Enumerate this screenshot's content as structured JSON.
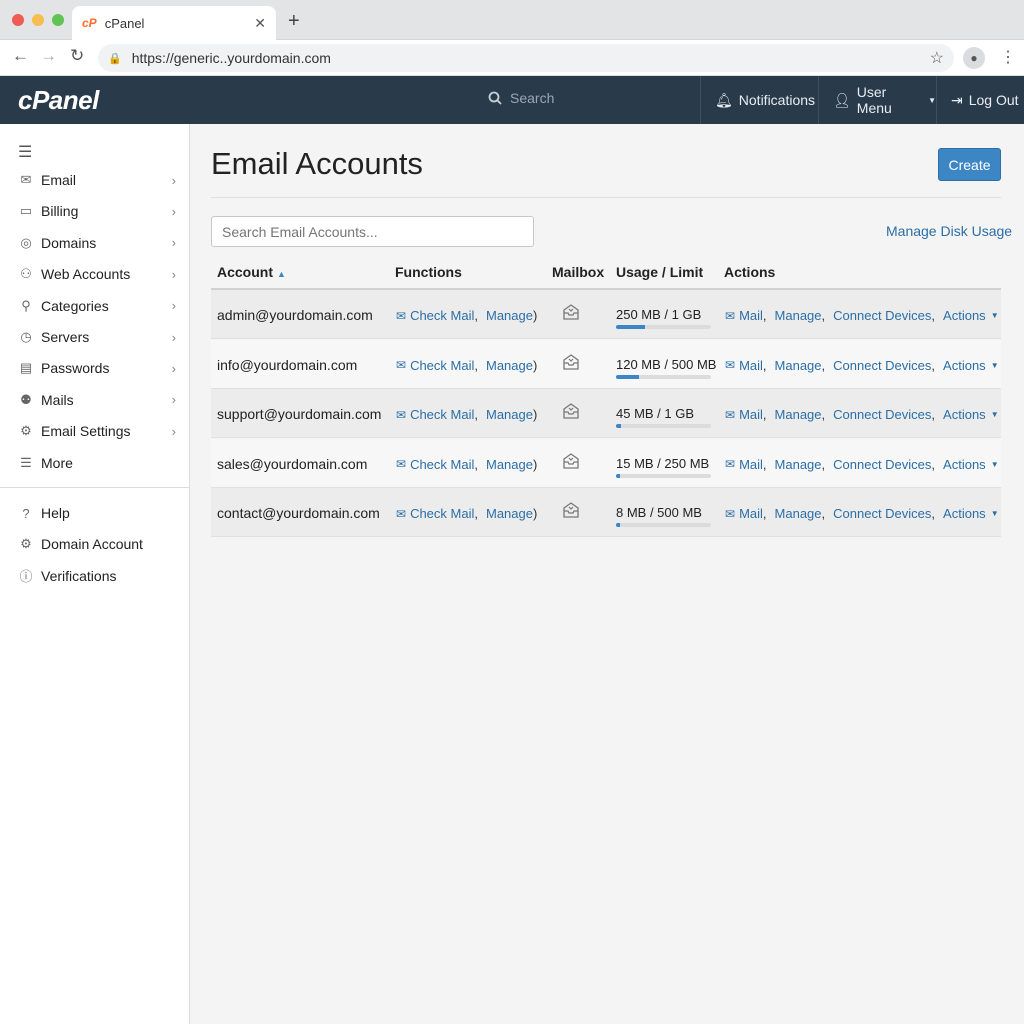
{
  "browser": {
    "tab_logo": "cP",
    "tab_title": "cPanel",
    "url": "https://generic..yourdomain.com"
  },
  "header": {
    "brand": "cPanel",
    "search_placeholder": "Search",
    "notifications": "Notifications",
    "user_menu": "User Menu",
    "log_out": "Log Out"
  },
  "sidebar": {
    "items": [
      {
        "label": "Email",
        "icon": "envelope-open-icon",
        "glyph": "✉"
      },
      {
        "label": "Billing",
        "icon": "billing-icon",
        "glyph": "▭"
      },
      {
        "label": "Domains",
        "icon": "globe-icon",
        "glyph": "◎"
      },
      {
        "label": "Web Accounts",
        "icon": "web-accounts-icon",
        "glyph": "⚇"
      },
      {
        "label": "Categories",
        "icon": "link-icon",
        "glyph": "⚲"
      },
      {
        "label": "Servers",
        "icon": "clock-icon",
        "glyph": "◷"
      },
      {
        "label": "Passwords",
        "icon": "folder-icon",
        "glyph": "▤"
      },
      {
        "label": "Mails",
        "icon": "users-icon",
        "glyph": "⚉"
      },
      {
        "label": "Email Settings",
        "icon": "gear-icon",
        "glyph": "⚙"
      },
      {
        "label": "More",
        "icon": "list-icon",
        "glyph": "☰"
      }
    ],
    "bottom_items": [
      {
        "label": "Help",
        "icon": "help-icon",
        "glyph": "?"
      },
      {
        "label": "Domain Account",
        "icon": "gear-icon",
        "glyph": "⚙"
      },
      {
        "label": "Verifications",
        "icon": "info-icon",
        "glyph": "ⓘ"
      }
    ]
  },
  "main": {
    "title": "Email Accounts",
    "create_label": "Create",
    "search_placeholder": "Search Email Accounts...",
    "manage_disk_usage": "Manage Disk Usage",
    "columns": [
      "Account",
      "Functions",
      "Mailbox",
      "Usage / Limit",
      "Actions"
    ],
    "function_links": {
      "check_mail": "Check Mail",
      "manage": "Manage"
    },
    "action_links": {
      "mail": "Mail",
      "manage": "Manage",
      "connect": "Connect Devices",
      "actions": "Actions"
    },
    "rows": [
      {
        "account": "admin@yourdomain.com",
        "usage": "250 MB / 1 GB",
        "fraction": 0.31
      },
      {
        "account": "info@yourdomain.com",
        "usage": "120 MB / 500 MB",
        "fraction": 0.24
      },
      {
        "account": "support@yourdomain.com",
        "usage": "45 MB / 1 GB",
        "fraction": 0.05
      },
      {
        "account": "sales@yourdomain.com",
        "usage": "15 MB / 250 MB",
        "fraction": 0.02
      },
      {
        "account": "contact@yourdomain.com",
        "usage": "8 MB / 500 MB",
        "fraction": 0.02
      }
    ]
  },
  "colors": {
    "accent": "#3d86c6",
    "header_bg": "#293a4a",
    "link": "#2b6ea6"
  }
}
